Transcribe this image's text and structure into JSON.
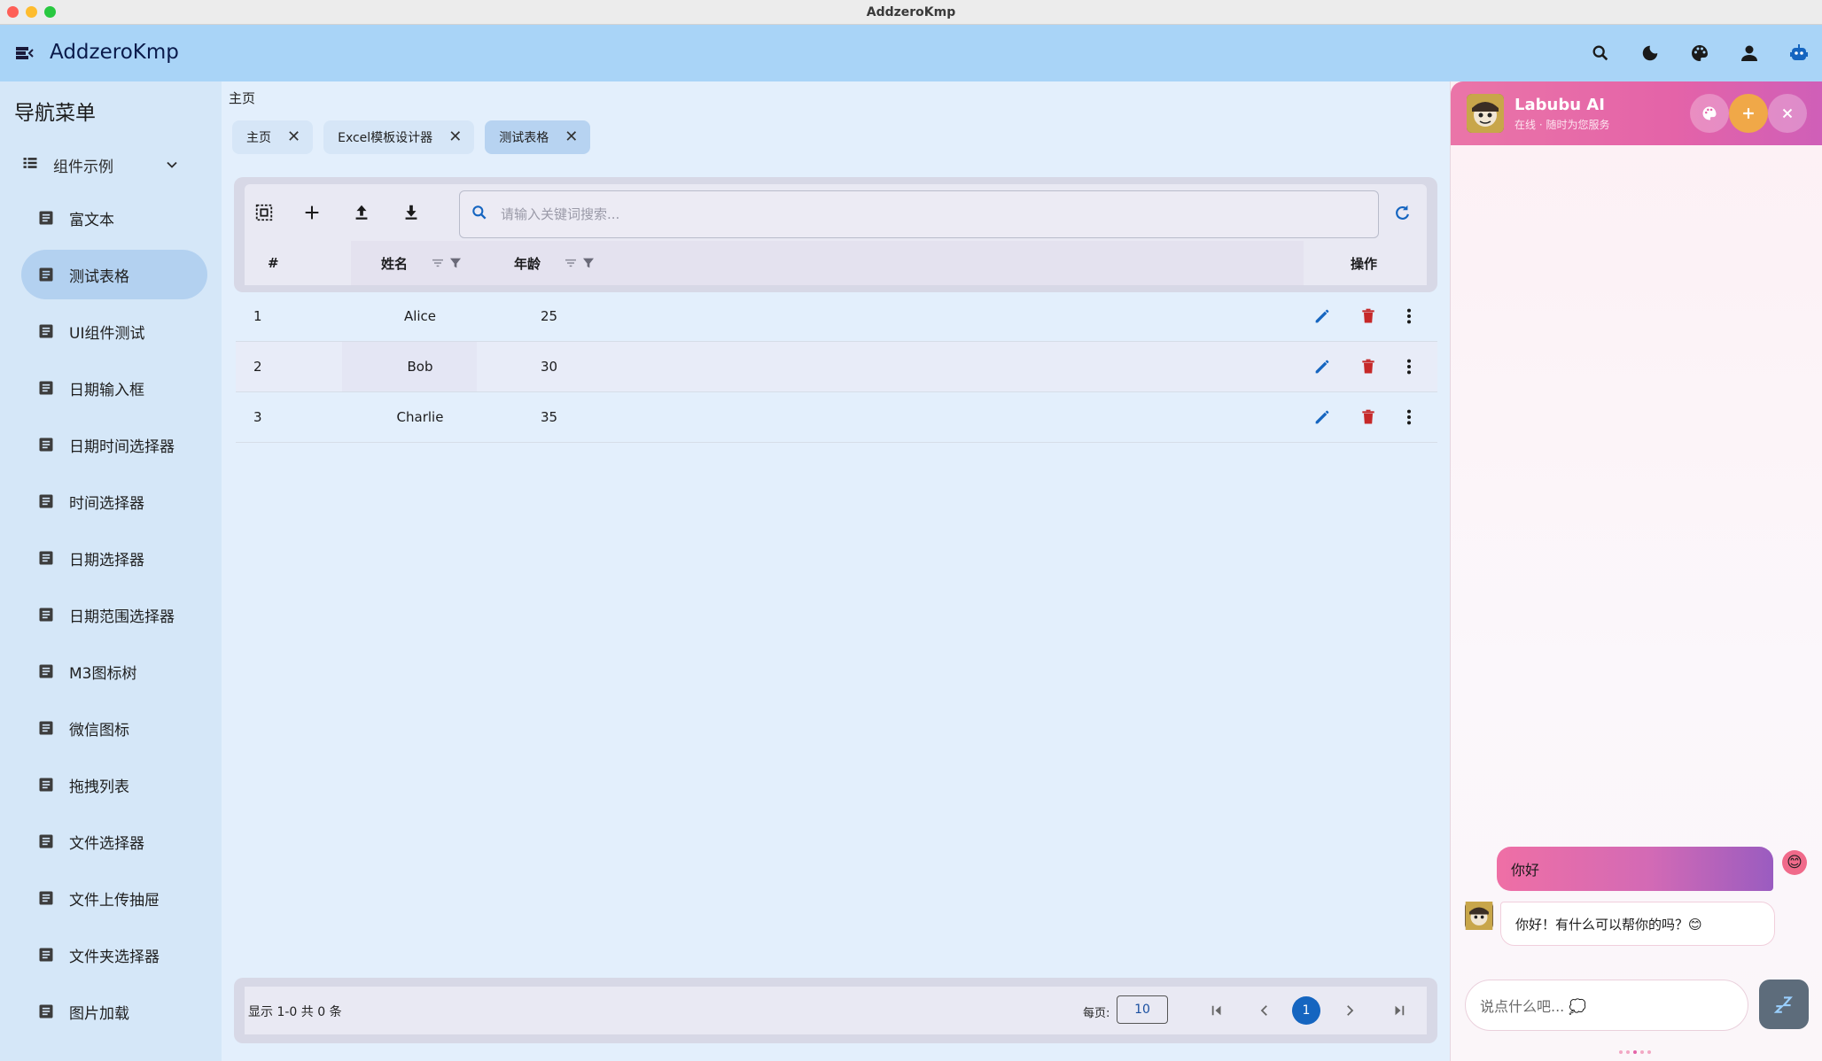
{
  "window": {
    "title": "AddzeroKmp"
  },
  "appbar": {
    "title": "AddzeroKmp"
  },
  "colors": {
    "appbar": "#a9d4f7",
    "sidebar": "#d5e7f8",
    "active": "#b3d1f0",
    "primary": "#1565c0",
    "delete": "#c62828",
    "chat_accent": "#e463a8"
  },
  "sidebar": {
    "title": "导航菜单",
    "group": "组件示例",
    "items": [
      {
        "label": "富文本"
      },
      {
        "label": "测试表格"
      },
      {
        "label": "UI组件测试"
      },
      {
        "label": "日期输入框"
      },
      {
        "label": "日期时间选择器"
      },
      {
        "label": "时间选择器"
      },
      {
        "label": "日期选择器"
      },
      {
        "label": "日期范围选择器"
      },
      {
        "label": "M3图标树"
      },
      {
        "label": "微信图标"
      },
      {
        "label": "拖拽列表"
      },
      {
        "label": "文件选择器"
      },
      {
        "label": "文件上传抽屉"
      },
      {
        "label": "文件夹选择器"
      },
      {
        "label": "图片加载"
      }
    ]
  },
  "main": {
    "breadcrumb": "主页",
    "tabs": [
      {
        "label": "主页"
      },
      {
        "label": "Excel模板设计器"
      },
      {
        "label": "测试表格"
      }
    ],
    "search_placeholder": "请输入关键词搜索...",
    "columns": {
      "index": "#",
      "name": "姓名",
      "age": "年龄",
      "actions": "操作"
    },
    "rows": [
      {
        "index": "1",
        "name": "Alice",
        "age": "25"
      },
      {
        "index": "2",
        "name": "Bob",
        "age": "30"
      },
      {
        "index": "3",
        "name": "Charlie",
        "age": "35"
      }
    ],
    "footer": {
      "info": "显示 1-0 共 0 条",
      "per_page_label": "每页:",
      "per_page_value": "10",
      "current_page": "1"
    }
  },
  "chat": {
    "name": "Labubu AI",
    "status": "在线 · 随时为您服务",
    "messages": [
      {
        "role": "user",
        "text": "你好",
        "emoji": "😊"
      },
      {
        "role": "bot",
        "text": "你好！有什么可以帮你的吗？😊"
      }
    ],
    "input_placeholder": "说点什么吧... 💭"
  }
}
